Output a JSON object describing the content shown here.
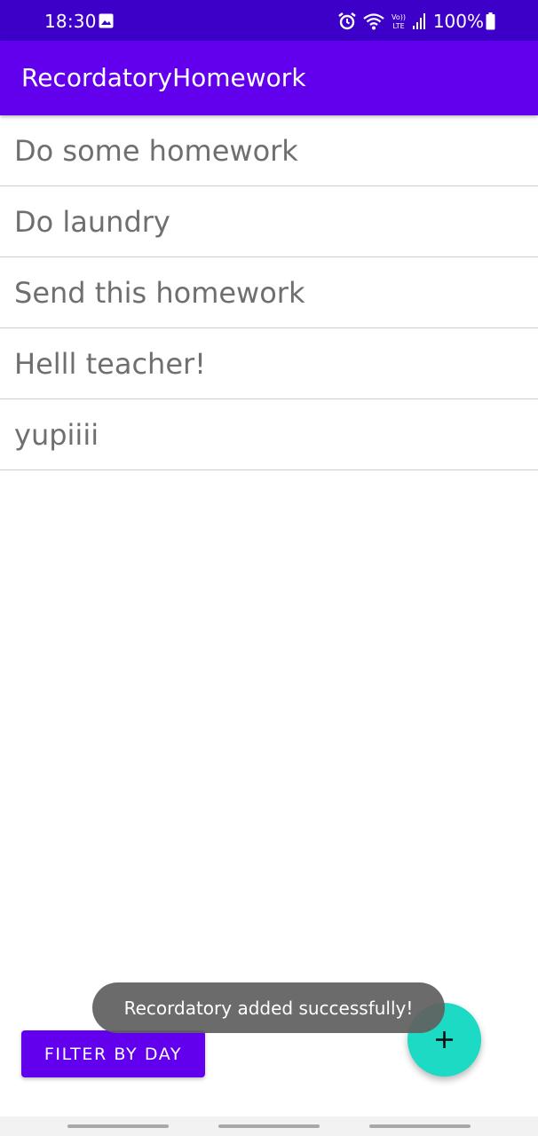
{
  "status_bar": {
    "time": "18:30",
    "battery": "100%",
    "icons": [
      "gallery-icon",
      "alarm-icon",
      "wifi-icon",
      "volte-icon",
      "signal-icon",
      "battery-icon"
    ]
  },
  "app_bar": {
    "title": "RecordatoryHomework"
  },
  "list": {
    "items": [
      {
        "text": "Do some homework"
      },
      {
        "text": "Do laundry"
      },
      {
        "text": "Send this homework"
      },
      {
        "text": "Helll teacher!"
      },
      {
        "text": "yupiiii"
      }
    ]
  },
  "filter_button": {
    "label": "FILTER BY DAY"
  },
  "fab": {
    "icon": "plus-icon"
  },
  "toast": {
    "text": "Recordatory added successfully!"
  },
  "colors": {
    "status_bar": "#3d00c9",
    "primary": "#6200ee",
    "accent": "#1ddac4",
    "list_text": "#6f6f6f"
  }
}
